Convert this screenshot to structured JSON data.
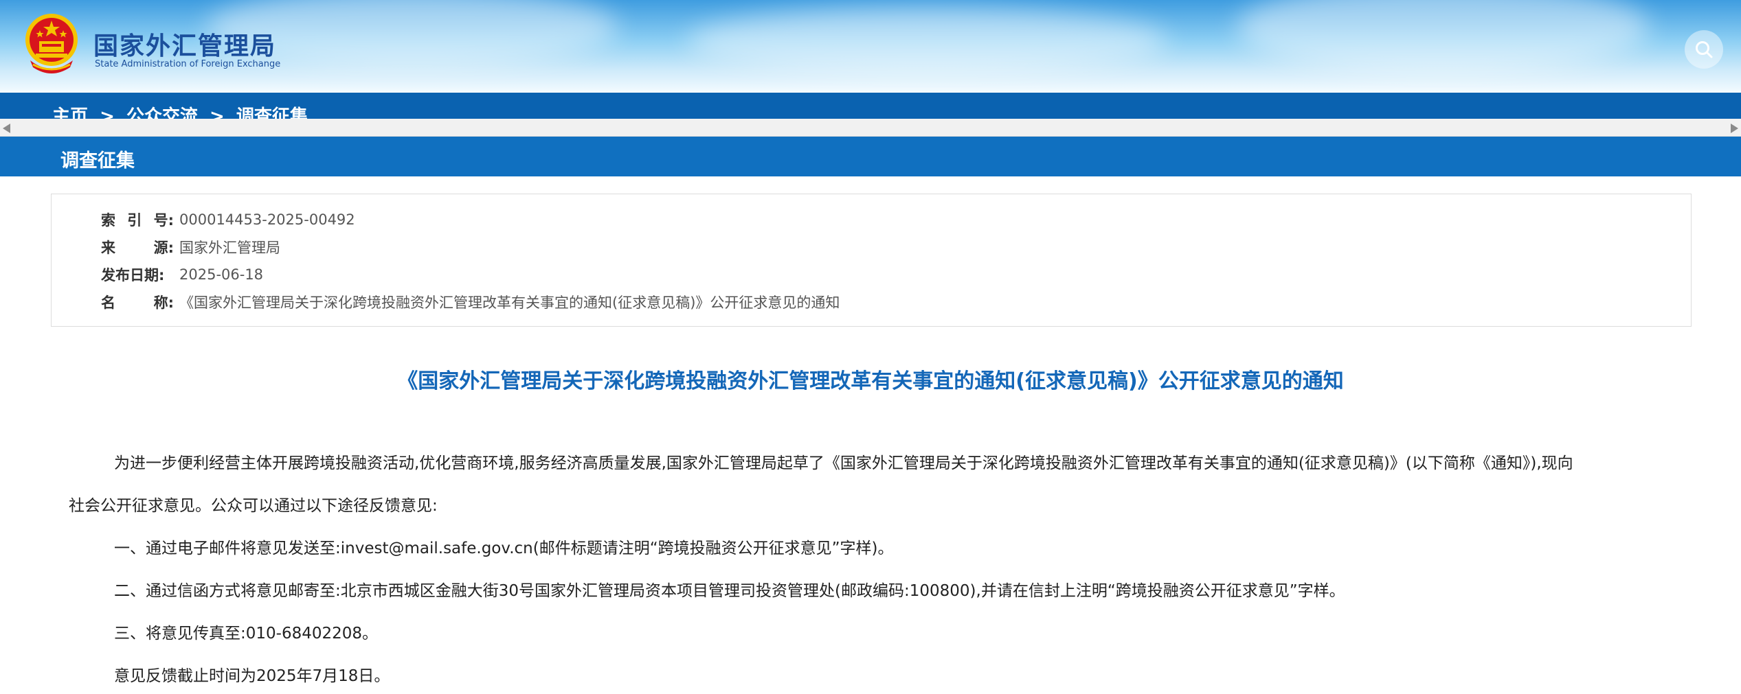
{
  "header": {
    "title_cn": "国家外汇管理局",
    "title_en": "State Administration of Foreign Exchange",
    "emblem_icon": "national-emblem-icon",
    "search_icon": "search-icon"
  },
  "breadcrumb": {
    "items": [
      "主页",
      "公众交流",
      "调查征集"
    ],
    "separator": ">"
  },
  "section": {
    "title": "调查征集"
  },
  "meta": {
    "index": {
      "label": [
        "索",
        "引",
        "号:"
      ],
      "value": "000014453-2025-00492"
    },
    "source": {
      "label": [
        "来",
        "",
        "源:"
      ],
      "value": "国家外汇管理局"
    },
    "date": {
      "label": [
        "发布日期:"
      ],
      "value": "2025-06-18"
    },
    "name": {
      "label": [
        "名",
        "",
        "称:"
      ],
      "value": "《国家外汇管理局关于深化跨境投融资外汇管理改革有关事宜的通知(征求意见稿)》公开征求意见的通知"
    }
  },
  "doc": {
    "title": "《国家外汇管理局关于深化跨境投融资外汇管理改革有关事宜的通知(征求意见稿)》公开征求意见的通知",
    "paragraph1_line1": "为进一步便利经营主体开展跨境投融资活动,优化营商环境,服务经济高质量发展,国家外汇管理局起草了《国家外汇管理局关于深化跨境投融资外汇管理改革有关事宜的通知(征求意见稿)》(以下简称《通知》),现向",
    "paragraph1_line2": "社会公开征求意见。公众可以通过以下途径反馈意见:",
    "item1": "一、通过电子邮件将意见发送至:invest@mail.safe.gov.cn(邮件标题请注明“跨境投融资公开征求意见”字样)。",
    "item2": "二、通过信函方式将意见邮寄至:北京市西城区金融大街30号国家外汇管理局资本项目管理司投资管理处(邮政编码:100800),并请在信封上注明“跨境投融资公开征求意见”字样。",
    "item3": "三、将意见传真至:010-68402208。",
    "deadline": "意见反馈截止时间为2025年7月18日。"
  },
  "colors": {
    "nav_blue": "#0a62b0",
    "section_blue": "#1070c0",
    "title_blue": "#1467b8"
  }
}
